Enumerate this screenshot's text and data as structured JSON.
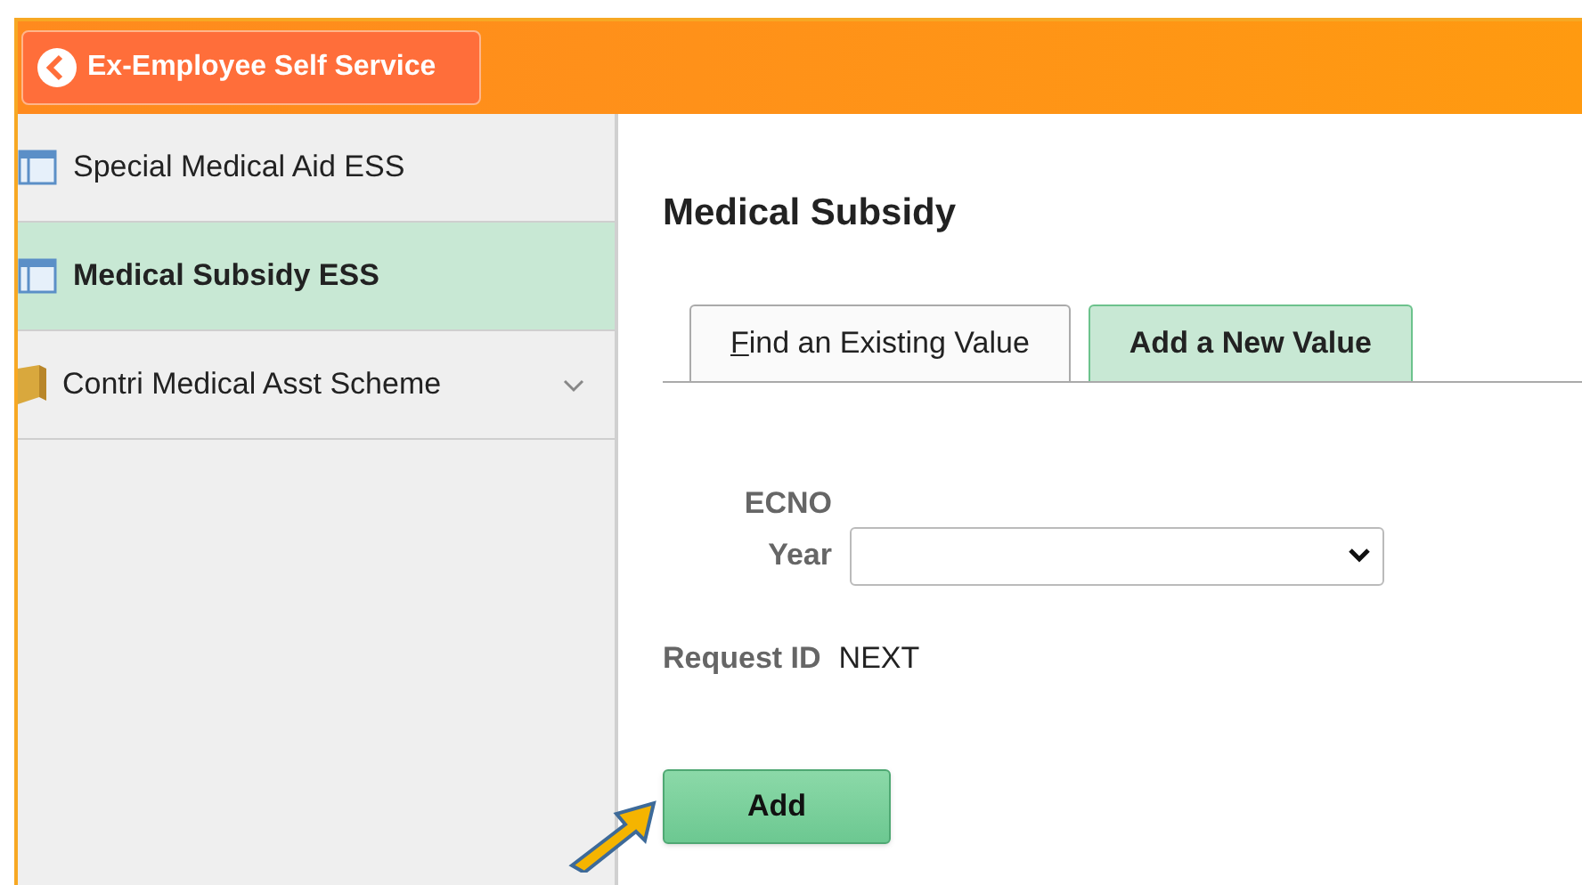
{
  "header": {
    "back_button": "Ex-Employee Self Service"
  },
  "sidebar": {
    "items": [
      {
        "label": "Special Medical Aid ESS",
        "kind": "page",
        "selected": false
      },
      {
        "label": "Medical Subsidy ESS",
        "kind": "page",
        "selected": true
      },
      {
        "label": "Contri Medical Asst Scheme",
        "kind": "folder",
        "selected": false,
        "expanded": false
      }
    ]
  },
  "page_title": "Medical Subsidy",
  "tabs": [
    {
      "label": "Find an Existing Value",
      "underline_first": true,
      "selected": false
    },
    {
      "label": "Add a New Value",
      "underline_first": false,
      "selected": true
    }
  ],
  "form": {
    "ecno_label": "ECNO",
    "year_label": "Year",
    "request_id_label": "Request ID",
    "request_id_value": "NEXT"
  },
  "add_button": "Add"
}
